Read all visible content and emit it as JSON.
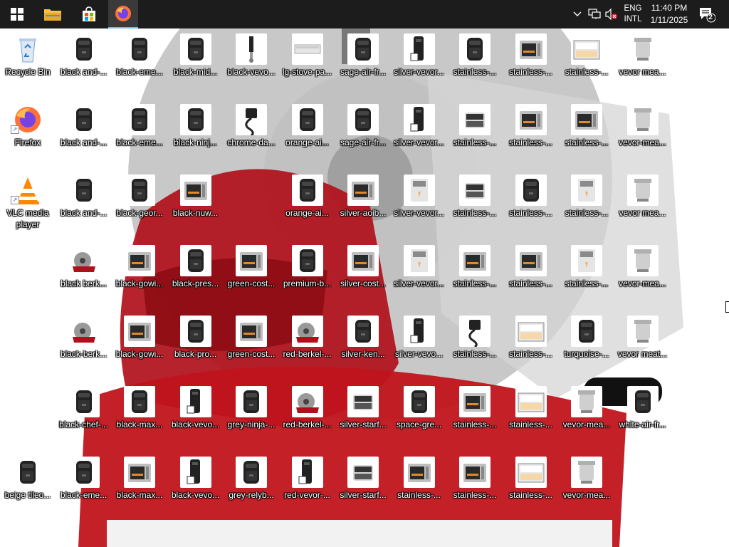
{
  "taskbar": {
    "language_primary": "ENG",
    "language_secondary": "INTL",
    "time": "11:40 PM",
    "date": "1/11/2025",
    "notification_count": "2",
    "pinned": [
      "start-icon",
      "file-explorer-icon",
      "microsoft-store-icon",
      "firefox-icon"
    ],
    "tray_icons": [
      "chevron-up-icon",
      "network-icon",
      "volume-muted-icon",
      "notification-icon"
    ]
  },
  "desktop": {
    "columns": [
      [
        {
          "label": "Recycle Bin",
          "icon": "recycle-bin-icon"
        },
        {
          "label": "Firefox",
          "icon": "firefox-icon",
          "shortcut": true
        },
        {
          "label": "VLC media player",
          "icon": "vlc-icon",
          "shortcut": true,
          "wrap": true
        },
        null,
        null,
        null,
        {
          "label": "beige tileo...",
          "icon": "air-fryer-icon"
        }
      ],
      [
        {
          "label": "black and-...",
          "icon": "air-fryer-icon"
        },
        {
          "label": "black and-...",
          "icon": "air-fryer-icon"
        },
        {
          "label": "black and-...",
          "icon": "air-fryer-icon"
        },
        {
          "label": "black berk...",
          "icon": "meat-slicer-icon"
        },
        {
          "label": "black-berk...",
          "icon": "meat-slicer-icon"
        },
        {
          "label": "black-chef-...",
          "icon": "air-fryer-icon"
        },
        {
          "label": "black-eme...",
          "icon": "air-fryer-icon"
        }
      ],
      [
        {
          "label": "black-eme...",
          "icon": "air-fryer-icon"
        },
        {
          "label": "black-eme...",
          "icon": "air-fryer-icon"
        },
        {
          "label": "black-geor...",
          "icon": "air-fryer-icon"
        },
        {
          "label": "black-gowi...",
          "icon": "oven-icon"
        },
        {
          "label": "black-gowi...",
          "icon": "oven-icon"
        },
        {
          "label": "black-max...",
          "icon": "air-fryer-icon"
        },
        {
          "label": "black-max...",
          "icon": "oven-icon"
        }
      ],
      [
        {
          "label": "black-mid...",
          "icon": "air-fryer-icon"
        },
        {
          "label": "black-ninj...",
          "icon": "air-fryer-icon"
        },
        {
          "label": "black-nuw...",
          "icon": "oven-icon"
        },
        {
          "label": "black-pres...",
          "icon": "air-fryer-icon"
        },
        {
          "label": "black-pro...",
          "icon": "air-fryer-icon"
        },
        {
          "label": "black-vevo...",
          "icon": "juicer-icon"
        },
        {
          "label": "black-vevo...",
          "icon": "juicer-icon"
        }
      ],
      [
        {
          "label": "black-vevo...",
          "icon": "mixer-icon"
        },
        {
          "label": "chrome-da...",
          "icon": "cable-icon"
        },
        null,
        {
          "label": "green-cost...",
          "icon": "oven-icon"
        },
        {
          "label": "green-cost...",
          "icon": "oven-icon"
        },
        {
          "label": "grey-ninja-...",
          "icon": "air-fryer-icon"
        },
        {
          "label": "grey-relyb...",
          "icon": "air-fryer-icon"
        }
      ],
      [
        {
          "label": "lg-stove-pa...",
          "icon": "stove-panel-icon"
        },
        {
          "label": "orange-ai...",
          "icon": "air-fryer-icon"
        },
        {
          "label": "orange-ai...",
          "icon": "air-fryer-icon"
        },
        {
          "label": "premium-b...",
          "icon": "air-fryer-icon"
        },
        {
          "label": "red-berkel-...",
          "icon": "meat-slicer-icon"
        },
        {
          "label": "red-berkel-...",
          "icon": "meat-slicer-icon"
        },
        {
          "label": "red-vevor-...",
          "icon": "juicer-icon"
        }
      ],
      [
        {
          "label": "sage-air-fr...",
          "icon": "air-fryer-icon"
        },
        {
          "label": "sage-air-fr...",
          "icon": "air-fryer-icon"
        },
        {
          "label": "silver-aoib...",
          "icon": "oven-icon"
        },
        {
          "label": "silver-cost...",
          "icon": "oven-icon"
        },
        {
          "label": "silver-ken...",
          "icon": "air-fryer-icon"
        },
        {
          "label": "silver-starf...",
          "icon": "grill-icon"
        },
        {
          "label": "silver-starf...",
          "icon": "grill-icon"
        }
      ],
      [
        {
          "label": "silver-vevor...",
          "icon": "juicer-icon"
        },
        {
          "label": "silver-vevor...",
          "icon": "juicer-icon"
        },
        {
          "label": "silver-vevor...",
          "icon": "ice-cream-machine-icon"
        },
        {
          "label": "silver-vevor...",
          "icon": "ice-cream-machine-icon"
        },
        {
          "label": "silver-vevo...",
          "icon": "juicer-icon"
        },
        {
          "label": "space-gre...",
          "icon": "air-fryer-icon"
        },
        {
          "label": "stainless-...",
          "icon": "oven-icon"
        }
      ],
      [
        {
          "label": "stainless-...",
          "icon": "air-fryer-icon"
        },
        {
          "label": "stainless-...",
          "icon": "grill-icon"
        },
        {
          "label": "stainless-...",
          "icon": "grill-icon"
        },
        {
          "label": "stainless-...",
          "icon": "oven-icon"
        },
        {
          "label": "stainless-...",
          "icon": "cable-icon"
        },
        {
          "label": "stainless-...",
          "icon": "oven-icon"
        },
        {
          "label": "stainless-...",
          "icon": "oven-icon"
        }
      ],
      [
        {
          "label": "stainless-...",
          "icon": "oven-icon"
        },
        {
          "label": "stainless-...",
          "icon": "oven-icon"
        },
        {
          "label": "stainless-...",
          "icon": "air-fryer-icon"
        },
        {
          "label": "stainless-...",
          "icon": "oven-icon"
        },
        {
          "label": "stainless-...",
          "icon": "display-case-icon"
        },
        {
          "label": "stainless-...",
          "icon": "display-case-icon"
        },
        {
          "label": "stainless-...",
          "icon": "display-case-icon"
        }
      ],
      [
        {
          "label": "stainless-...",
          "icon": "display-case-icon"
        },
        {
          "label": "stainless-...",
          "icon": "oven-icon"
        },
        {
          "label": "stainless-...",
          "icon": "ice-cream-machine-icon"
        },
        {
          "label": "stainless-...",
          "icon": "ice-cream-machine-icon"
        },
        {
          "label": "turquoise-...",
          "icon": "air-fryer-icon"
        },
        {
          "label": "vevor-mea...",
          "icon": "meat-grinder-icon"
        },
        {
          "label": "vevor-mea...",
          "icon": "meat-grinder-icon"
        }
      ],
      [
        {
          "label": "vevor mea...",
          "icon": "meat-grinder-icon"
        },
        {
          "label": "vevor-mea...",
          "icon": "meat-grinder-icon"
        },
        {
          "label": "vevor mea...",
          "icon": "meat-grinder-icon"
        },
        {
          "label": "vevor-mea...",
          "icon": "meat-grinder-icon"
        },
        {
          "label": "vevor meat...",
          "icon": "meat-grinder-icon"
        },
        {
          "label": "white-air-fr...",
          "icon": "air-fryer-icon"
        },
        null
      ]
    ]
  },
  "colors": {
    "taskbar_bg": "#1c1c1c",
    "active_indicator": "#76b9ed",
    "slicer_red": "#c0141c",
    "wallpaper_white": "#ffffff"
  }
}
